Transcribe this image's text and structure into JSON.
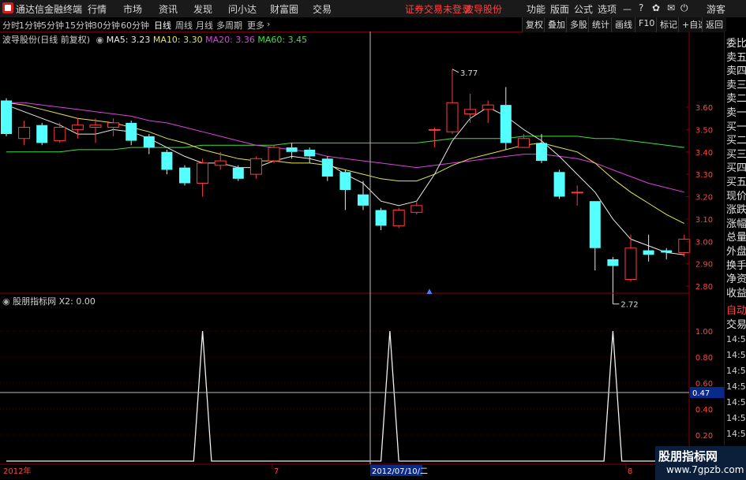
{
  "app": {
    "title": "通达信金融终端",
    "menu": [
      "行情",
      "市场",
      "资讯",
      "发现",
      "问小达",
      "财富圈",
      "交易"
    ],
    "warning": "证券交易未登录",
    "stock": "波导股份",
    "right_menu": [
      "功能",
      "版面",
      "公式",
      "选项"
    ],
    "guest": "游客"
  },
  "periods": [
    "分时",
    "1分钟",
    "5分钟",
    "15分钟",
    "30分钟",
    "60分钟",
    "日线",
    "周线",
    "月线",
    "多周期",
    "更多"
  ],
  "active_period": "日线",
  "toolbar": [
    "复权",
    "叠加",
    "多股",
    "统计",
    "画线",
    "F10",
    "标记",
    "+自选",
    "返回"
  ],
  "legend_main": {
    "name": "波导股份(日线 前复权)",
    "ma5": "MA5: 3.23",
    "ma10": "MA10: 3.30",
    "ma20": "MA20: 3.36",
    "ma60": "MA60: 3.45"
  },
  "legend_sub": {
    "name": "股朋指标网",
    "value": "X2: 0.00"
  },
  "annotations": {
    "high": "3.77",
    "low": "2.72"
  },
  "cursor": {
    "date_label": "2012/07/10/二",
    "price_label": "0.47"
  },
  "x_labels": {
    "year": "2012年",
    "month7": "7",
    "month8": "8"
  },
  "right_panel": {
    "items": [
      "委比",
      "卖五",
      "卖四",
      "卖三",
      "卖二",
      "卖一",
      "买一",
      "买二",
      "买三",
      "买四",
      "买五",
      "现价",
      "涨跌",
      "涨幅",
      "总量",
      "外盘",
      "换手",
      "净资",
      "收益"
    ],
    "lower": [
      "自动",
      "交易"
    ],
    "times": [
      "14:56",
      "14:56",
      "14:56",
      "14:56",
      "14:56",
      "14:56",
      "14:56",
      "14:56",
      "14:56"
    ]
  },
  "watermark": {
    "line1": "股朋指标网",
    "line2": "www.7gpzb.com"
  },
  "colors": {
    "up": "#ff3c3c",
    "down": "#54ffff",
    "ma5": "#e8e8e8",
    "ma10": "#e6e64a",
    "ma20": "#e040e0",
    "ma60": "#40e040",
    "axis": "#8a0000",
    "grid": "#5a0000"
  },
  "chart_data": [
    {
      "type": "candlestick",
      "title": "波导股份(日线 前复权)",
      "ylim": [
        2.72,
        3.77
      ],
      "yticks": [
        3.6,
        3.5,
        3.4,
        3.3,
        3.2,
        3.1,
        3.0,
        2.9,
        2.8
      ],
      "candles": [
        {
          "o": 3.63,
          "c": 3.48,
          "h": 3.64,
          "l": 3.47
        },
        {
          "o": 3.46,
          "c": 3.51,
          "h": 3.54,
          "l": 3.43
        },
        {
          "o": 3.52,
          "c": 3.44,
          "h": 3.53,
          "l": 3.43
        },
        {
          "o": 3.45,
          "c": 3.51,
          "h": 3.53,
          "l": 3.44
        },
        {
          "o": 3.5,
          "c": 3.52,
          "h": 3.55,
          "l": 3.46
        },
        {
          "o": 3.51,
          "c": 3.52,
          "h": 3.55,
          "l": 3.44
        },
        {
          "o": 3.51,
          "c": 3.53,
          "h": 3.55,
          "l": 3.47
        },
        {
          "o": 3.53,
          "c": 3.45,
          "h": 3.54,
          "l": 3.43
        },
        {
          "o": 3.47,
          "c": 3.42,
          "h": 3.48,
          "l": 3.39
        },
        {
          "o": 3.4,
          "c": 3.32,
          "h": 3.41,
          "l": 3.3
        },
        {
          "o": 3.33,
          "c": 3.26,
          "h": 3.34,
          "l": 3.25
        },
        {
          "o": 3.26,
          "c": 3.35,
          "h": 3.37,
          "l": 3.2
        },
        {
          "o": 3.34,
          "c": 3.36,
          "h": 3.4,
          "l": 3.32
        },
        {
          "o": 3.33,
          "c": 3.28,
          "h": 3.34,
          "l": 3.27
        },
        {
          "o": 3.3,
          "c": 3.37,
          "h": 3.38,
          "l": 3.28
        },
        {
          "o": 3.36,
          "c": 3.42,
          "h": 3.43,
          "l": 3.35
        },
        {
          "o": 3.42,
          "c": 3.4,
          "h": 3.44,
          "l": 3.37
        },
        {
          "o": 3.41,
          "c": 3.38,
          "h": 3.42,
          "l": 3.35
        },
        {
          "o": 3.37,
          "c": 3.29,
          "h": 3.38,
          "l": 3.27
        },
        {
          "o": 3.31,
          "c": 3.23,
          "h": 3.32,
          "l": 3.14
        },
        {
          "o": 3.21,
          "c": 3.16,
          "h": 3.27,
          "l": 3.14
        },
        {
          "o": 3.14,
          "c": 3.07,
          "h": 3.15,
          "l": 3.05
        },
        {
          "o": 3.07,
          "c": 3.14,
          "h": 3.15,
          "l": 3.06
        },
        {
          "o": 3.13,
          "c": 3.16,
          "h": 3.18,
          "l": 3.12
        },
        {
          "o": 3.5,
          "c": 3.5,
          "h": 3.51,
          "l": 3.42
        },
        {
          "o": 3.49,
          "c": 3.62,
          "h": 3.77,
          "l": 3.48
        },
        {
          "o": 3.57,
          "c": 3.59,
          "h": 3.66,
          "l": 3.53
        },
        {
          "o": 3.59,
          "c": 3.61,
          "h": 3.63,
          "l": 3.53
        },
        {
          "o": 3.61,
          "c": 3.44,
          "h": 3.69,
          "l": 3.41
        },
        {
          "o": 3.42,
          "c": 3.46,
          "h": 3.48,
          "l": 3.42
        },
        {
          "o": 3.44,
          "c": 3.36,
          "h": 3.48,
          "l": 3.35
        },
        {
          "o": 3.31,
          "c": 3.2,
          "h": 3.32,
          "l": 3.19
        },
        {
          "o": 3.22,
          "c": 3.22,
          "h": 3.25,
          "l": 3.16
        },
        {
          "o": 3.18,
          "c": 2.97,
          "h": 3.18,
          "l": 2.87
        },
        {
          "o": 2.92,
          "c": 2.89,
          "h": 2.93,
          "l": 2.72
        },
        {
          "o": 2.83,
          "c": 2.97,
          "h": 3.03,
          "l": 2.82
        },
        {
          "o": 2.96,
          "c": 2.94,
          "h": 3.03,
          "l": 2.91
        },
        {
          "o": 2.96,
          "c": 2.95,
          "h": 2.97,
          "l": 2.92
        },
        {
          "o": 2.95,
          "c": 3.01,
          "h": 3.03,
          "l": 2.93
        }
      ],
      "ma5": [
        3.61,
        3.58,
        3.55,
        3.52,
        3.48,
        3.48,
        3.5,
        3.49,
        3.46,
        3.42,
        3.38,
        3.35,
        3.35,
        3.33,
        3.33,
        3.36,
        3.38,
        3.37,
        3.35,
        3.3,
        3.26,
        3.18,
        3.16,
        3.18,
        3.3,
        3.45,
        3.55,
        3.6,
        3.56,
        3.5,
        3.45,
        3.38,
        3.3,
        3.22,
        3.1,
        3.01,
        2.98,
        2.95,
        2.94
      ],
      "ma10": [
        3.62,
        3.61,
        3.59,
        3.57,
        3.55,
        3.54,
        3.53,
        3.51,
        3.49,
        3.46,
        3.44,
        3.41,
        3.39,
        3.37,
        3.36,
        3.36,
        3.35,
        3.35,
        3.34,
        3.32,
        3.3,
        3.28,
        3.27,
        3.27,
        3.3,
        3.34,
        3.37,
        3.39,
        3.41,
        3.43,
        3.44,
        3.42,
        3.4,
        3.35,
        3.28,
        3.22,
        3.17,
        3.12,
        3.08
      ],
      "ma20": [
        3.62,
        3.62,
        3.61,
        3.6,
        3.59,
        3.58,
        3.57,
        3.56,
        3.54,
        3.53,
        3.51,
        3.49,
        3.47,
        3.45,
        3.43,
        3.42,
        3.41,
        3.4,
        3.38,
        3.37,
        3.36,
        3.35,
        3.34,
        3.33,
        3.34,
        3.35,
        3.36,
        3.37,
        3.38,
        3.39,
        3.39,
        3.38,
        3.37,
        3.35,
        3.32,
        3.29,
        3.26,
        3.24,
        3.22
      ],
      "ma60": [
        3.4,
        3.4,
        3.4,
        3.4,
        3.41,
        3.41,
        3.41,
        3.42,
        3.42,
        3.42,
        3.42,
        3.43,
        3.43,
        3.43,
        3.43,
        3.43,
        3.44,
        3.44,
        3.44,
        3.44,
        3.44,
        3.44,
        3.44,
        3.44,
        3.45,
        3.46,
        3.46,
        3.46,
        3.46,
        3.47,
        3.47,
        3.47,
        3.47,
        3.46,
        3.46,
        3.45,
        3.44,
        3.43,
        3.42
      ]
    },
    {
      "type": "line",
      "title": "股朋指标网",
      "ylim": [
        0,
        1
      ],
      "yticks": [
        1.0,
        0.8,
        0.6,
        0.4,
        0.2
      ],
      "x": [
        0,
        10.5,
        11.0,
        11.5,
        21.0,
        21.5,
        22.0,
        33.5,
        34.0,
        34.5,
        38
      ],
      "values": [
        0,
        0,
        1,
        0,
        0,
        1,
        0,
        0,
        1,
        0,
        0
      ]
    }
  ]
}
